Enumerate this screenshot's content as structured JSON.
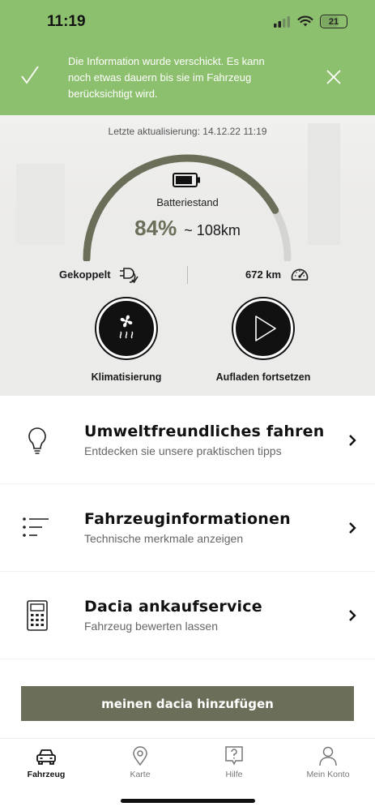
{
  "status_bar": {
    "time": "11:19",
    "battery": "21"
  },
  "notification": {
    "message": "Die Information wurde verschickt. Es kann noch etwas dauern bis sie im Fahrzeug berücksichtigt wird."
  },
  "vehicle": {
    "last_update": "Letzte aktualisierung: 14.12.22 11:19",
    "battery_label": "Batteriestand",
    "battery_percent": "84%",
    "battery_level": 0.84,
    "range": "~ 108km",
    "coupled_label": "Gekoppelt",
    "odometer": "672 km"
  },
  "actions": [
    {
      "label": "Klimatisierung",
      "icon": "fan-heat-icon"
    },
    {
      "label": "Aufladen fortsetzen",
      "icon": "play-icon"
    }
  ],
  "menu": [
    {
      "title": "Umweltfreundliches fahren",
      "subtitle": "Entdecken sie unsere praktischen tipps",
      "icon": "lightbulb-icon"
    },
    {
      "title": "Fahrzeuginformationen",
      "subtitle": "Technische merkmale anzeigen",
      "icon": "list-icon"
    },
    {
      "title": "Dacia ankaufservice",
      "subtitle": "Fahrzeug bewerten lassen",
      "icon": "calculator-icon"
    }
  ],
  "add_button": "meinen dacia hinzufügen",
  "tabs": [
    {
      "label": "Fahrzeug",
      "icon": "car-icon",
      "active": true
    },
    {
      "label": "Karte",
      "icon": "map-pin-icon",
      "active": false
    },
    {
      "label": "Hilfe",
      "icon": "help-icon",
      "active": false
    },
    {
      "label": "Mein Konto",
      "icon": "user-icon",
      "active": false
    }
  ],
  "colors": {
    "accent": "#6b6e58",
    "notification": "#8dc06e",
    "gauge_track": "#d4d4d2"
  }
}
